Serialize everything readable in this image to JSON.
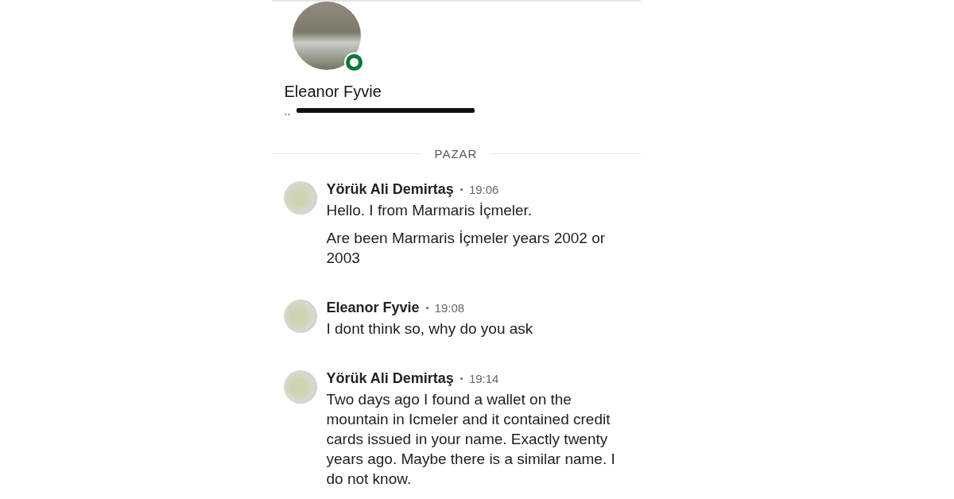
{
  "profile": {
    "name": "Eleanor Fyvie",
    "headline": "..",
    "headline_redacted": true,
    "online": true
  },
  "date_divider": "PAZAR",
  "messages": [
    {
      "sender": "Yörük Ali Demirtaş",
      "time": "19:06",
      "paragraphs": [
        "Hello. I from Marmaris İçmeler.",
        "Are been Marmaris İçmeler years 2002 or 2003"
      ]
    },
    {
      "sender": "Eleanor Fyvie",
      "time": "19:08",
      "paragraphs": [
        "I dont think so, why do you ask"
      ]
    },
    {
      "sender": "Yörük Ali Demirtaş",
      "time": "19:14",
      "paragraphs": [
        "Two days ago I found a wallet on the mountain in Icmeler and it contained credit cards issued in your name. Exactly twenty years ago. Maybe there is a similar name. I do not know."
      ]
    }
  ]
}
